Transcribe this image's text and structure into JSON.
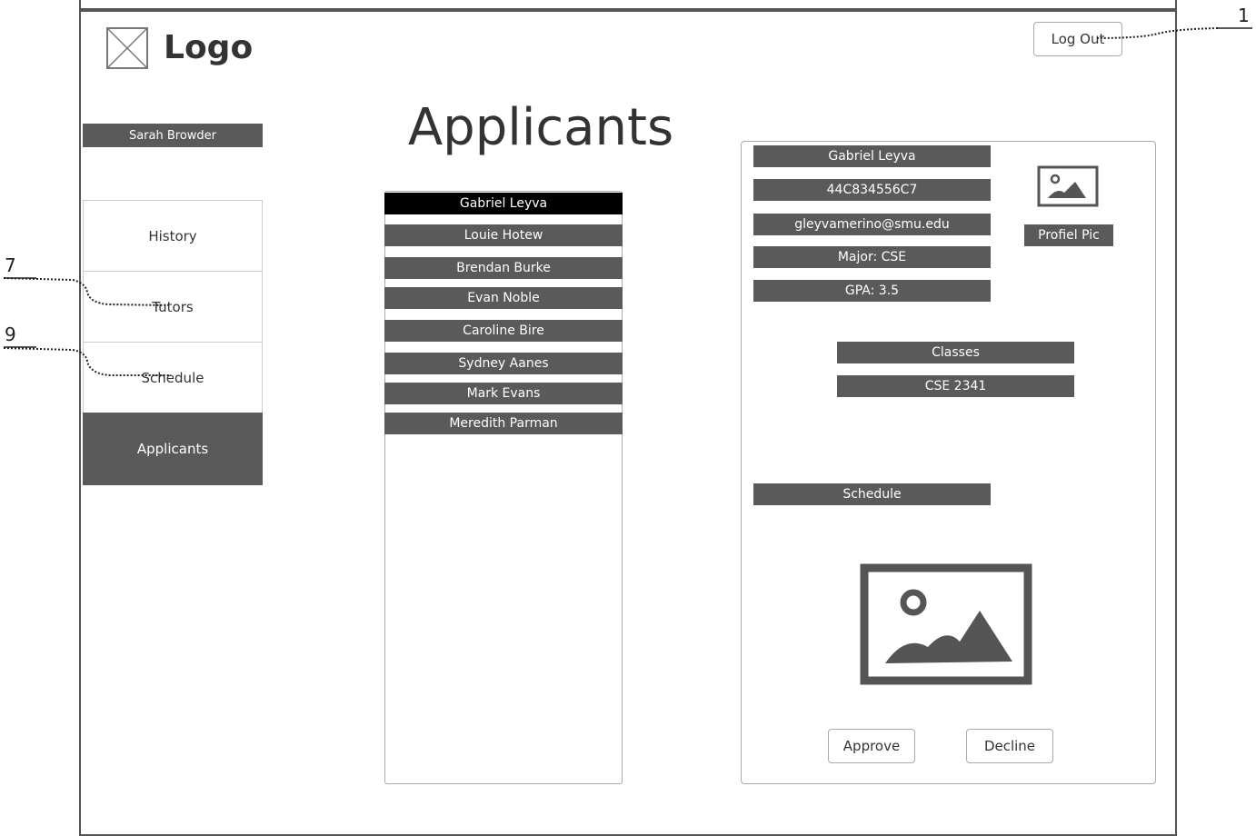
{
  "header": {
    "logo_label": "Logo",
    "logout_label": "Log Out"
  },
  "sidebar": {
    "user_name": "Sarah Browder",
    "items": [
      {
        "label": "History"
      },
      {
        "label": "Tutors"
      },
      {
        "label": "Schedule"
      },
      {
        "label": "Applicants",
        "active": true
      }
    ]
  },
  "main": {
    "title": "Applicants",
    "applicants": [
      {
        "name": "Gabriel Leyva",
        "selected": true
      },
      {
        "name": "Louie Hotew"
      },
      {
        "name": "Brendan Burke"
      },
      {
        "name": "Evan Noble"
      },
      {
        "name": "Caroline Bire"
      },
      {
        "name": "Sydney Aanes"
      },
      {
        "name": "Mark Evans"
      },
      {
        "name": "Meredith Parman"
      }
    ]
  },
  "detail": {
    "name": "Gabriel Leyva",
    "id": "44C834556C7",
    "email": "gleyvamerino@smu.edu",
    "major": "Major: CSE",
    "gpa": "GPA: 3.5",
    "profile_pic_label": "Profiel Pic",
    "classes_label": "Classes",
    "classes": [
      "CSE 2341"
    ],
    "schedule_label": "Schedule",
    "approve_label": "Approve",
    "decline_label": "Decline"
  },
  "callouts": [
    "1",
    "7",
    "9"
  ],
  "colors": {
    "bar": "#5a5a5a",
    "selected": "#000000",
    "border": "#aaaaaa"
  }
}
